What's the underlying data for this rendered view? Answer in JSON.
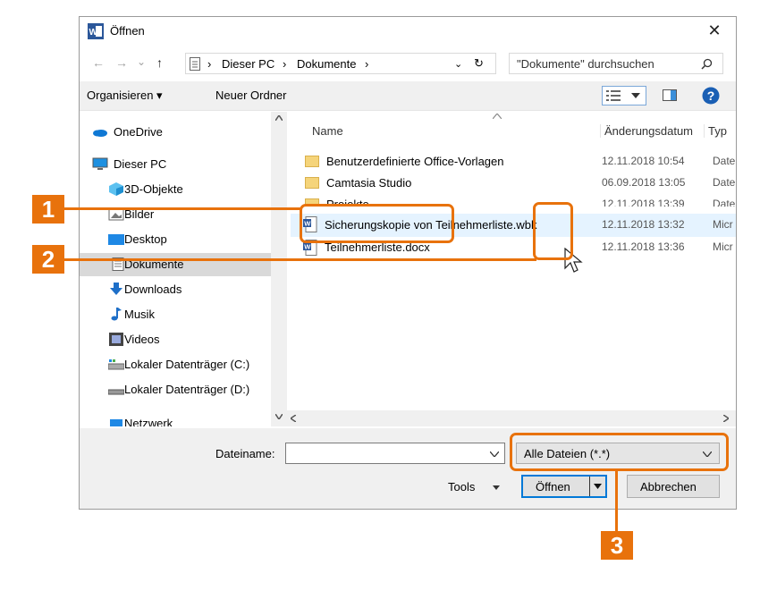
{
  "dialog": {
    "title": "Öffnen",
    "close_glyph": "✕"
  },
  "nav": {
    "back_glyph": "←",
    "forward_glyph": "→",
    "recent_glyph": "⌄",
    "up_glyph": "↑",
    "breadcrumb": [
      "Dieser PC",
      "Dokumente"
    ],
    "separator": "›",
    "refresh_glyph": "↻",
    "search_placeholder": "\"Dokumente\" durchsuchen"
  },
  "toolbar": {
    "organize_label": "Organisieren ▾",
    "new_folder_label": "Neuer Ordner"
  },
  "navpane": {
    "items": [
      {
        "label": "OneDrive",
        "icon": "onedrive-icon"
      },
      {
        "label": "Dieser PC",
        "icon": "computer-icon"
      },
      {
        "label": "3D-Objekte",
        "icon": "cube-icon"
      },
      {
        "label": "Bilder",
        "icon": "pictures-icon"
      },
      {
        "label": "Desktop",
        "icon": "desktop-icon"
      },
      {
        "label": "Dokumente",
        "icon": "documents-icon",
        "selected": true
      },
      {
        "label": "Downloads",
        "icon": "download-icon"
      },
      {
        "label": "Musik",
        "icon": "music-icon"
      },
      {
        "label": "Videos",
        "icon": "video-icon"
      },
      {
        "label": "Lokaler Datenträger (C:)",
        "icon": "drive-icon"
      },
      {
        "label": "Lokaler Datenträger (D:)",
        "icon": "drive-icon"
      },
      {
        "label": "Netzwerk",
        "icon": "network-icon"
      }
    ]
  },
  "filelist": {
    "columns": {
      "name": "Name",
      "date": "Änderungsdatum",
      "type": "Typ"
    },
    "rows": [
      {
        "name": "Benutzerdefinierte Office-Vorlagen",
        "date": "12.11.2018 10:54",
        "type": "Date",
        "kind": "folder"
      },
      {
        "name": "Camtasia Studio",
        "date": "06.09.2018 13:05",
        "type": "Date",
        "kind": "folder"
      },
      {
        "name": "Projekte",
        "date": "12.11.2018 13:39",
        "type": "Date",
        "kind": "folder"
      },
      {
        "name": "Sicherungskopie von Teilnehmerliste.wbk",
        "date": "12.11.2018 13:32",
        "type": "Micr",
        "kind": "word",
        "highlighted": true
      },
      {
        "name": "Teilnehmerliste.docx",
        "date": "12.11.2018 13:36",
        "type": "Micr",
        "kind": "word"
      }
    ]
  },
  "footer": {
    "filename_label": "Dateiname:",
    "filename_value": "",
    "filter_value": "Alle Dateien (*.*)",
    "tools_label": "Tools",
    "open_label": "Öffnen",
    "cancel_label": "Abbrechen"
  },
  "callouts": [
    "1",
    "2",
    "3"
  ],
  "colors": {
    "accent": "#e8720c",
    "selection": "#d9d9d9",
    "hover": "#e5f3ff"
  }
}
